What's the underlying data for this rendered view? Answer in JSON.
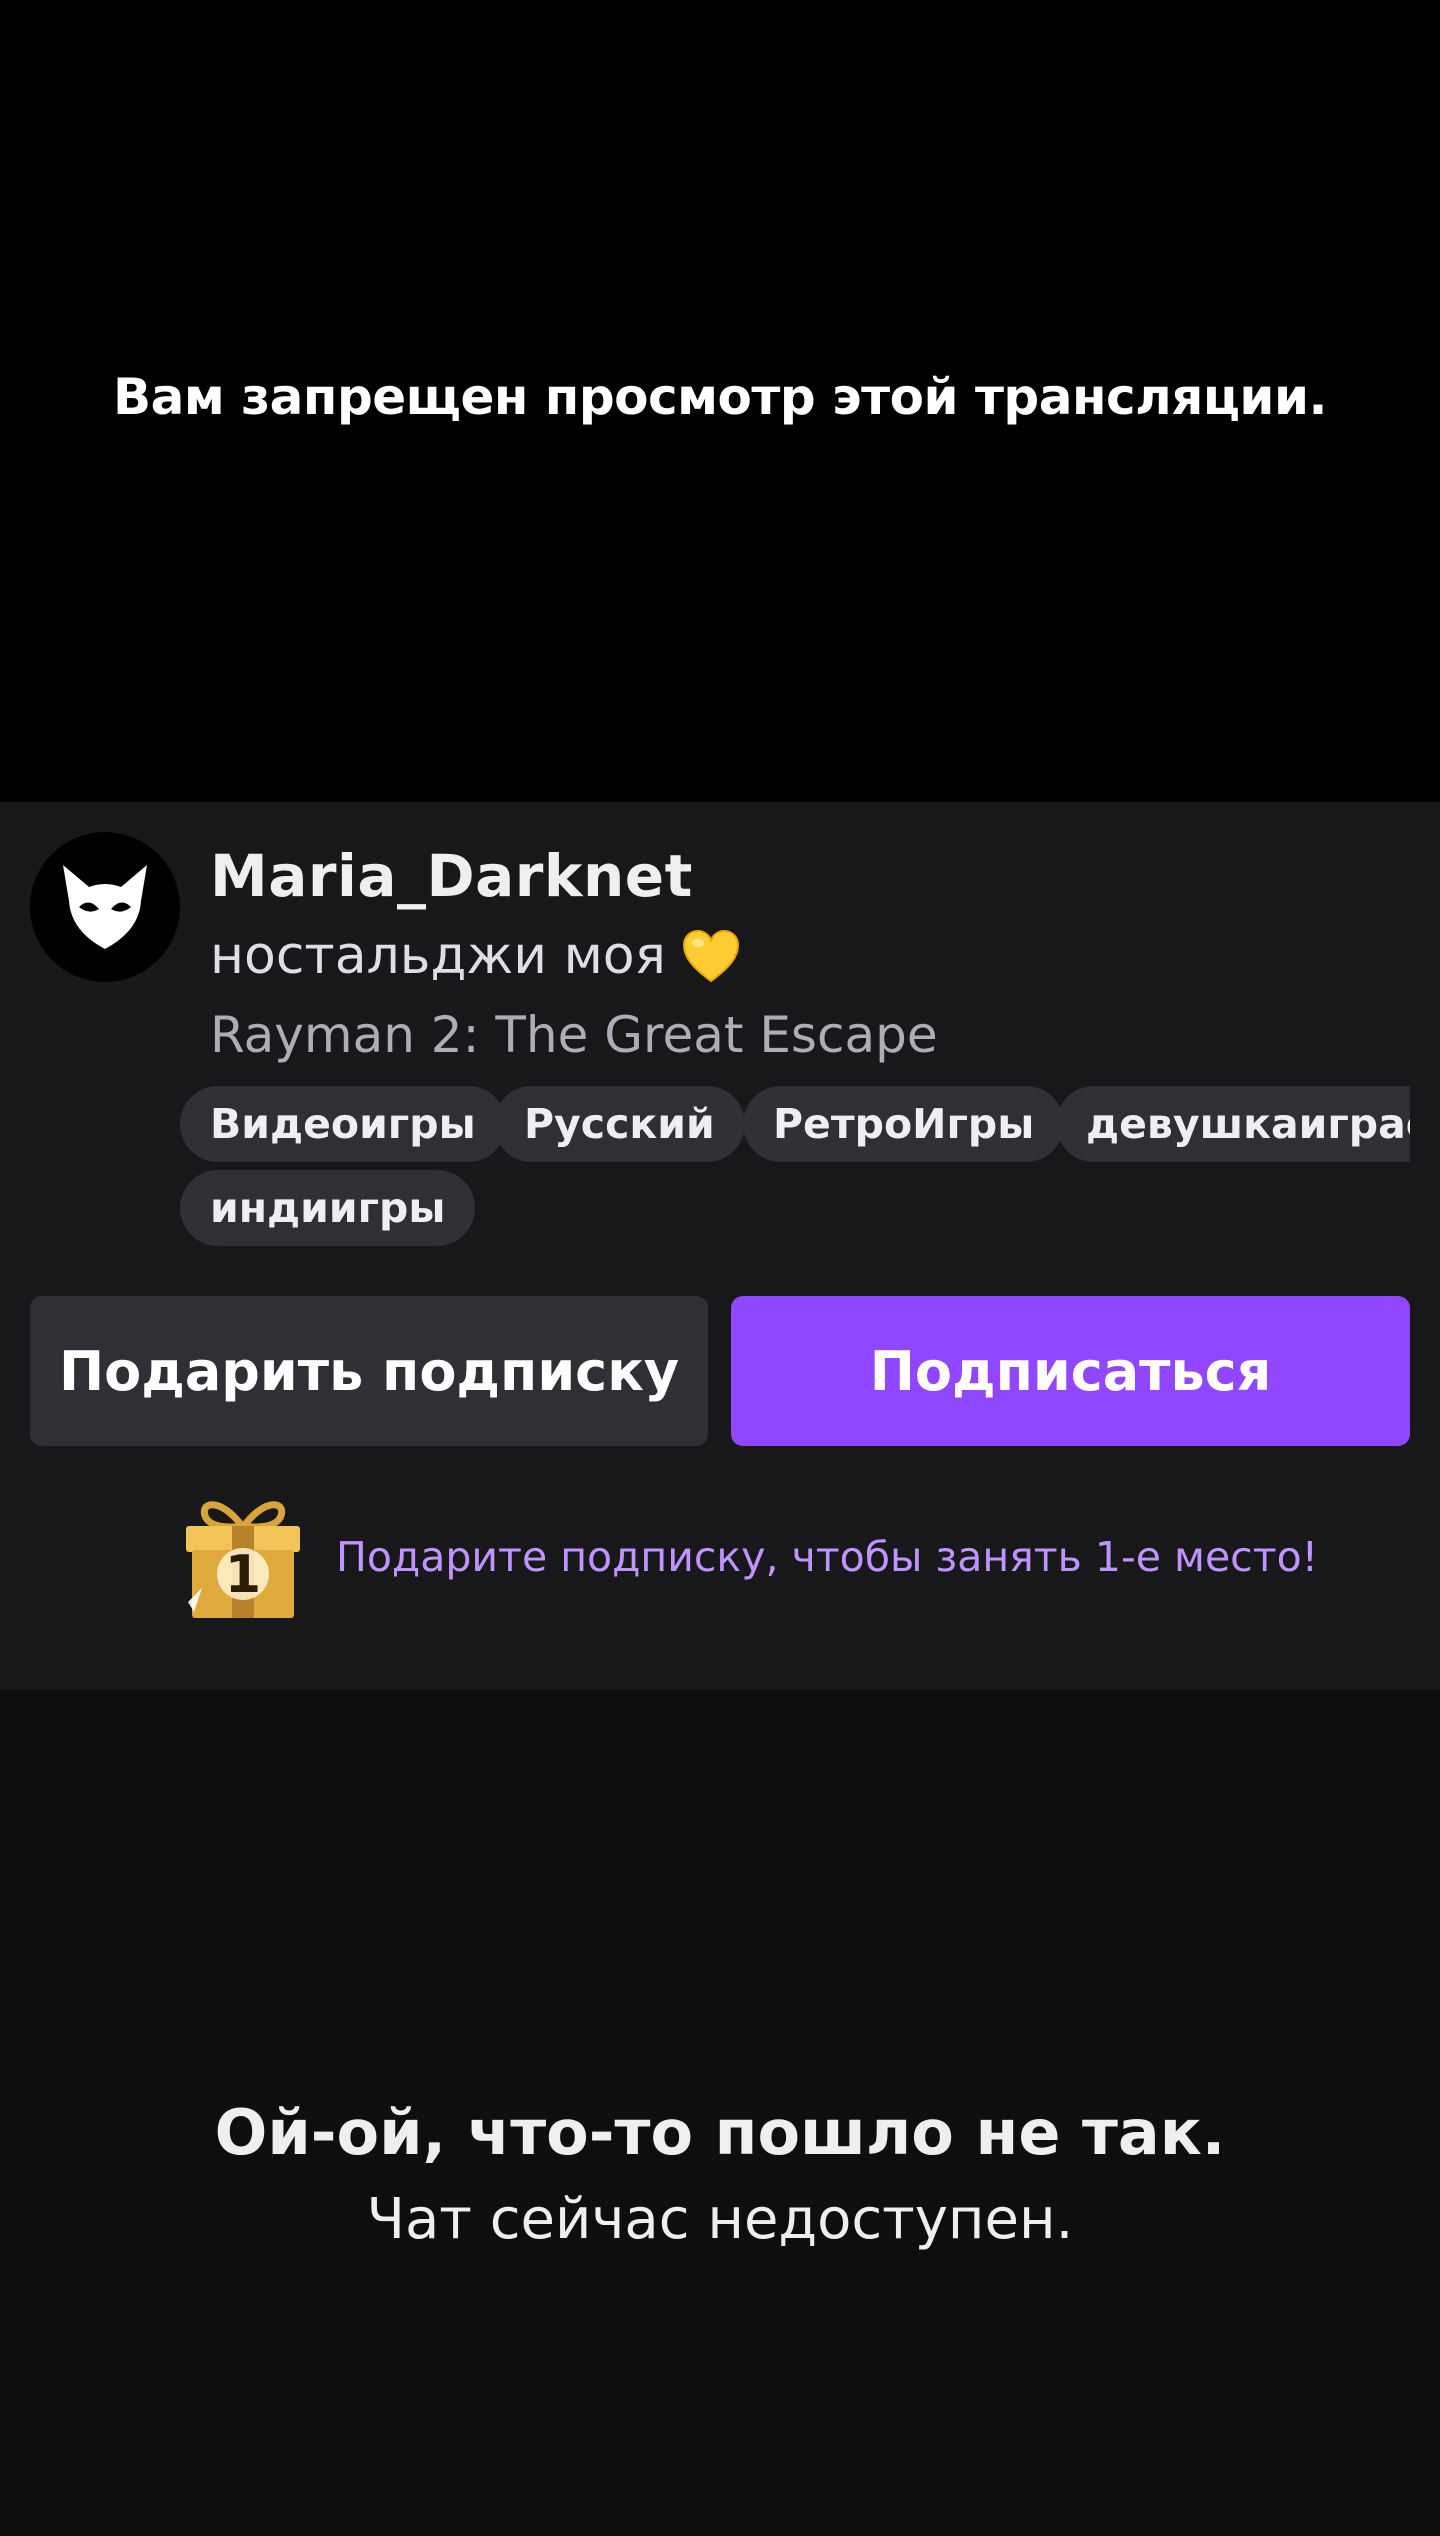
{
  "player": {
    "message": "Вам запрещен просмотр этой трансляции."
  },
  "channel": {
    "avatar_icon": "white-cat-mask-icon",
    "name": "Maria_Darknet",
    "stream_title": "ностальджи моя",
    "title_emoji_icon": "yellow-heart-icon",
    "game": "Rayman 2: The Great Escape",
    "tags": [
      "Видеоигры",
      "Русский",
      "РетроИгры",
      "девушкаиграет",
      "индиигры"
    ]
  },
  "actions": {
    "gift_label": "Подарить подписку",
    "subscribe_label": "Подписаться"
  },
  "promo": {
    "icon": "gift-rank-1-icon",
    "text": "Подарите подписку, чтобы занять 1-е место!"
  },
  "chat": {
    "error_title": "Ой-ой, что-то пошло не так.",
    "error_subtitle": "Чат сейчас недоступен."
  },
  "colors": {
    "accent": "#9147ff",
    "promo_text": "#bf94ff",
    "panel_bg": "#18181b",
    "page_bg": "#0e0e10"
  }
}
